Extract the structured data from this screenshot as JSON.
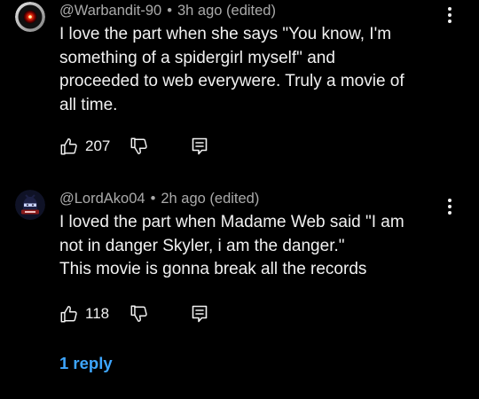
{
  "comments": [
    {
      "author": "@Warbandit-90",
      "time": "3h ago (edited)",
      "separator": "•",
      "lines": [
        "I love the part when she says \"You know, I'm",
        "something of a spidergirl myself\" and",
        "proceeded to web everywere. Truly a movie of",
        "all time."
      ],
      "likes": "207",
      "icons": {
        "avatar": "hal-9000-avatar",
        "like": "thumbs-up-icon",
        "dislike": "thumbs-down-icon",
        "reply": "reply-icon",
        "more": "more-vertical-icon"
      }
    },
    {
      "author": "@LordAko04",
      "time": "2h ago (edited)",
      "separator": "•",
      "lines": [
        "I loved the part when Madame Web said \"I am",
        "not in danger Skyler, i am the danger.\"",
        "This movie is gonna break all the records"
      ],
      "likes": "118",
      "icons": {
        "avatar": "ninja-avatar",
        "like": "thumbs-up-icon",
        "dislike": "thumbs-down-icon",
        "reply": "reply-icon",
        "more": "more-vertical-icon"
      }
    }
  ],
  "replies_link": "1 reply",
  "colors": {
    "background": "#000000",
    "text": "#f1f1f1",
    "meta": "#aaaaaa",
    "link": "#3ea6ff"
  }
}
